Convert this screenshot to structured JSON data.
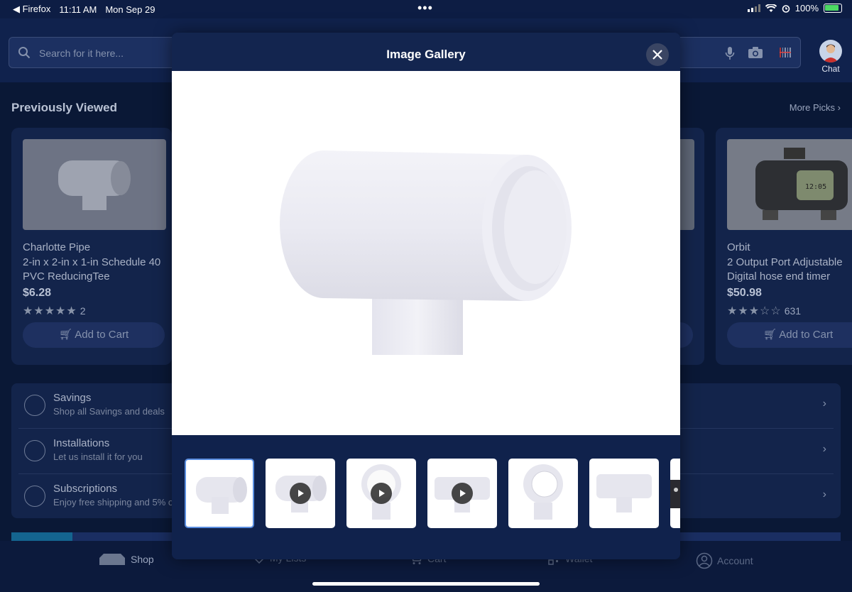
{
  "status_bar": {
    "back_app": "Firefox",
    "time": "11:11 AM",
    "date": "Mon Sep 29",
    "battery": "100%"
  },
  "header": {
    "search_placeholder": "Search for it here...",
    "chat_label": "Chat"
  },
  "previously_viewed": {
    "title": "Previously Viewed",
    "more_link": "More Picks",
    "cards": [
      {
        "brand": "Charlotte Pipe",
        "name": "2-in x 2-in x 1-in Schedule 40 PVC ReducingTee",
        "price": "$6.28",
        "stars": "★★★★★",
        "rating_count": "2",
        "cart_label": "Add to Cart"
      },
      {
        "brand": "Orbit",
        "name": "2 Output Port Adjustable Digital hose end timer",
        "price": "$50.98",
        "stars": "★★★☆☆",
        "rating_count": "631",
        "cart_label": "Add to Cart"
      }
    ]
  },
  "menu": [
    {
      "title": "Savings",
      "subtitle": "Shop all Savings and deals"
    },
    {
      "title": "Installations",
      "subtitle": "Let us install it for you"
    },
    {
      "title": "Subscriptions",
      "subtitle": "Enjoy free shipping and 5% o"
    }
  ],
  "tabbar": [
    {
      "label": "Shop",
      "active": true
    },
    {
      "label": "My Lists",
      "active": false
    },
    {
      "label": "Cart",
      "active": false
    },
    {
      "label": "Wallet",
      "active": false
    },
    {
      "label": "Account",
      "active": false
    }
  ],
  "gallery": {
    "title": "Image Gallery",
    "thumbnails": [
      {
        "view": "side",
        "video": false,
        "selected": true
      },
      {
        "view": "side",
        "video": true,
        "selected": false
      },
      {
        "view": "top",
        "video": true,
        "selected": false
      },
      {
        "view": "front",
        "video": true,
        "selected": false
      },
      {
        "view": "top",
        "video": false,
        "selected": false
      },
      {
        "view": "front",
        "video": false,
        "selected": false
      },
      {
        "view": "dark",
        "video": false,
        "selected": false
      }
    ]
  },
  "colors": {
    "background": "#0b1b3f",
    "modal": "#10224c",
    "selected_border": "#5a8ee0"
  }
}
